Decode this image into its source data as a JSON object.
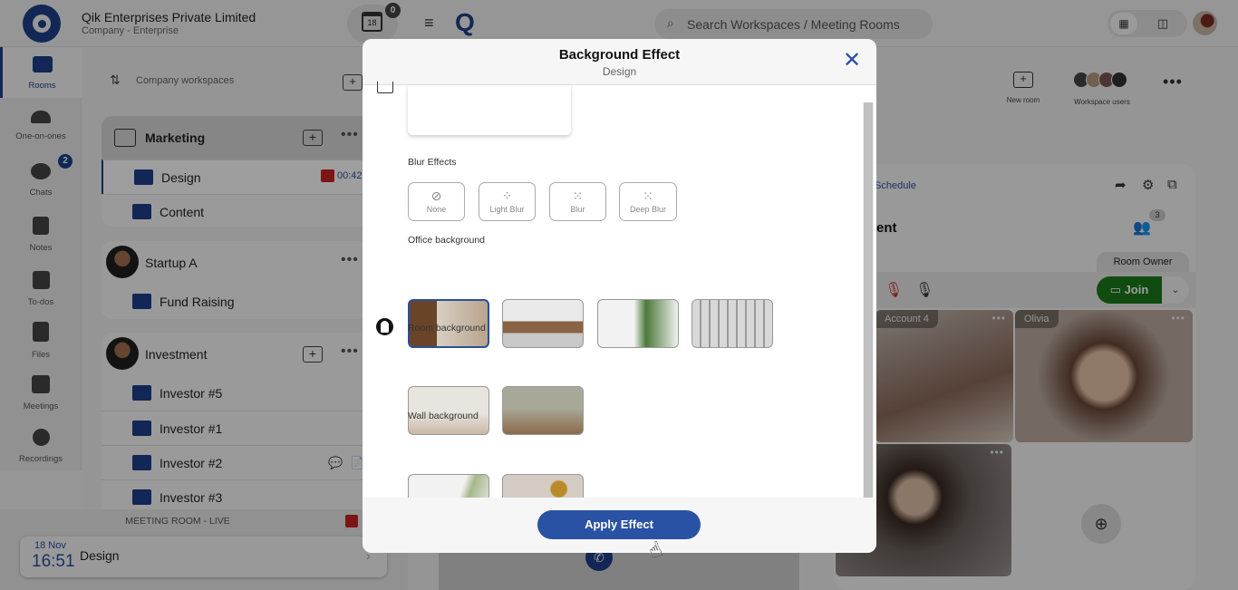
{
  "company": {
    "name": "Qik Enterprises Private Limited",
    "type": "Company - Enterprise",
    "calendar_day": "18",
    "calendar_badge": "0"
  },
  "rail": {
    "items": [
      {
        "label": "Rooms",
        "icon": "rooms-icon",
        "active": true
      },
      {
        "label": "One-on-ones",
        "icon": "one-on-ones-icon"
      },
      {
        "label": "Chats",
        "icon": "chats-icon",
        "badge": "2"
      },
      {
        "label": "Notes",
        "icon": "notes-icon"
      },
      {
        "label": "To-dos",
        "icon": "todos-icon"
      },
      {
        "label": "Files",
        "icon": "files-icon"
      },
      {
        "label": "Meetings",
        "icon": "meetings-icon"
      },
      {
        "label": "Recordings",
        "icon": "recordings-icon"
      }
    ]
  },
  "workspaces": {
    "header": "Company workspaces",
    "groups": [
      {
        "title": "Marketing",
        "rooms": [
          {
            "name": "Design",
            "recording": "00:42"
          },
          {
            "name": "Content"
          }
        ]
      },
      {
        "title": "Startup A",
        "rooms": [
          {
            "name": "Fund Raising"
          }
        ]
      },
      {
        "title": "Investment",
        "rooms": [
          {
            "name": "Investor #5"
          },
          {
            "name": "Investor #1"
          },
          {
            "name": "Investor #2"
          },
          {
            "name": "Investor #3"
          }
        ]
      }
    ]
  },
  "live": {
    "label": "MEETING ROOM - LIVE",
    "date": "18 Nov",
    "time": "16:51",
    "room": "Design"
  },
  "topbar": {
    "search_placeholder": "Search Workspaces / Meeting Rooms"
  },
  "room_panel": {
    "new_room": "New room",
    "workspace_users": "Workspace users",
    "schedule": "Schedule",
    "title": "tent",
    "participants_badge": "3",
    "owner_label": "Room Owner",
    "join_label": "Join",
    "tiles": [
      {
        "name": "Account 4"
      },
      {
        "name": "Olivia"
      },
      {
        "name": ""
      }
    ]
  },
  "modal": {
    "title": "Background Effect",
    "subtitle": "Design",
    "blur_section": "Blur Effects",
    "blur_options": [
      "None",
      "Light Blur",
      "Blur",
      "Deep Blur"
    ],
    "office_section": "Office background",
    "room_section": "Room background",
    "wall_section": "Wall background",
    "apply_label": "Apply Effect"
  },
  "colors": {
    "brand": "#1e3f8a",
    "accent": "#2a52a4",
    "join": "#1a7a1a",
    "record": "#cc2222"
  }
}
